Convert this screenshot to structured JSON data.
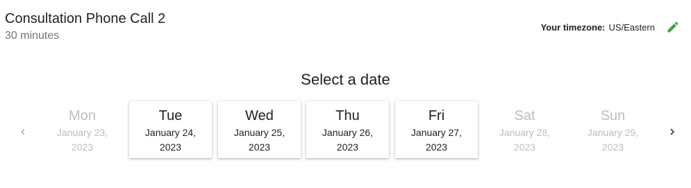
{
  "event": {
    "title": "Consultation Phone Call 2",
    "duration": "30 minutes"
  },
  "timezone": {
    "label": "Your timezone:",
    "value": "US/Eastern",
    "edit_icon": "pencil-icon",
    "edit_icon_color": "#43a047"
  },
  "picker": {
    "title": "Select a date",
    "prev_icon": "chevron-left-icon",
    "next_icon": "chevron-right-icon",
    "days": [
      {
        "name": "Mon",
        "date": "January 23, 2023",
        "available": false
      },
      {
        "name": "Tue",
        "date": "January 24, 2023",
        "available": true
      },
      {
        "name": "Wed",
        "date": "January 25, 2023",
        "available": true
      },
      {
        "name": "Thu",
        "date": "January 26, 2023",
        "available": true
      },
      {
        "name": "Fri",
        "date": "January 27, 2023",
        "available": true
      },
      {
        "name": "Sat",
        "date": "January 28, 2023",
        "available": false
      },
      {
        "name": "Sun",
        "date": "January 29, 2023",
        "available": false
      }
    ]
  }
}
